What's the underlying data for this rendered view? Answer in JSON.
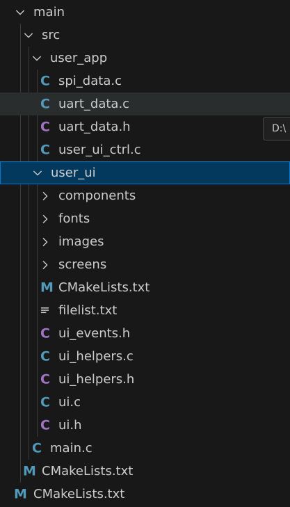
{
  "explorer": {
    "rows": [
      {
        "label": "main",
        "kind": "folder",
        "expanded": true
      },
      {
        "label": "src",
        "kind": "folder",
        "expanded": true
      },
      {
        "label": "user_app",
        "kind": "folder",
        "expanded": true
      },
      {
        "label": "spi_data.c",
        "kind": "file",
        "icon": "c-source-icon"
      },
      {
        "label": "uart_data.c",
        "kind": "file",
        "icon": "c-source-icon",
        "state": "hover"
      },
      {
        "label": "uart_data.h",
        "kind": "file",
        "icon": "c-header-icon"
      },
      {
        "label": "user_ui_ctrl.c",
        "kind": "file",
        "icon": "c-source-icon"
      },
      {
        "label": "user_ui",
        "kind": "folder",
        "expanded": true,
        "state": "selected"
      },
      {
        "label": "components",
        "kind": "folder",
        "expanded": false
      },
      {
        "label": "fonts",
        "kind": "folder",
        "expanded": false
      },
      {
        "label": "images",
        "kind": "folder",
        "expanded": false
      },
      {
        "label": "screens",
        "kind": "folder",
        "expanded": false
      },
      {
        "label": "CMakeLists.txt",
        "kind": "file",
        "icon": "cmake-icon"
      },
      {
        "label": "filelist.txt",
        "kind": "file",
        "icon": "text-file-icon"
      },
      {
        "label": "ui_events.h",
        "kind": "file",
        "icon": "c-header-icon"
      },
      {
        "label": "ui_helpers.c",
        "kind": "file",
        "icon": "c-source-icon"
      },
      {
        "label": "ui_helpers.h",
        "kind": "file",
        "icon": "c-header-icon"
      },
      {
        "label": "ui.c",
        "kind": "file",
        "icon": "c-source-icon"
      },
      {
        "label": "ui.h",
        "kind": "file",
        "icon": "c-header-icon"
      },
      {
        "label": "main.c",
        "kind": "file",
        "icon": "c-source-icon"
      },
      {
        "label": "CMakeLists.txt",
        "kind": "file",
        "icon": "cmake-icon"
      },
      {
        "label": "CMakeLists.txt",
        "kind": "file",
        "icon": "cmake-icon"
      }
    ],
    "icon_glyphs": {
      "c-source-icon": "C",
      "c-header-icon": "C",
      "cmake-icon": "M"
    }
  },
  "tooltip": {
    "text": "D:\\"
  },
  "colors": {
    "background": "#181818",
    "text": "#cccccc",
    "hover": "#2a2d2e",
    "selected": "#04395e",
    "focus_border": "#0078d4",
    "c_source": "#519aba",
    "c_header": "#a074c4",
    "cmake": "#519aba",
    "text_file": "#cccccc",
    "indent_guide": "#3c3c3c"
  }
}
